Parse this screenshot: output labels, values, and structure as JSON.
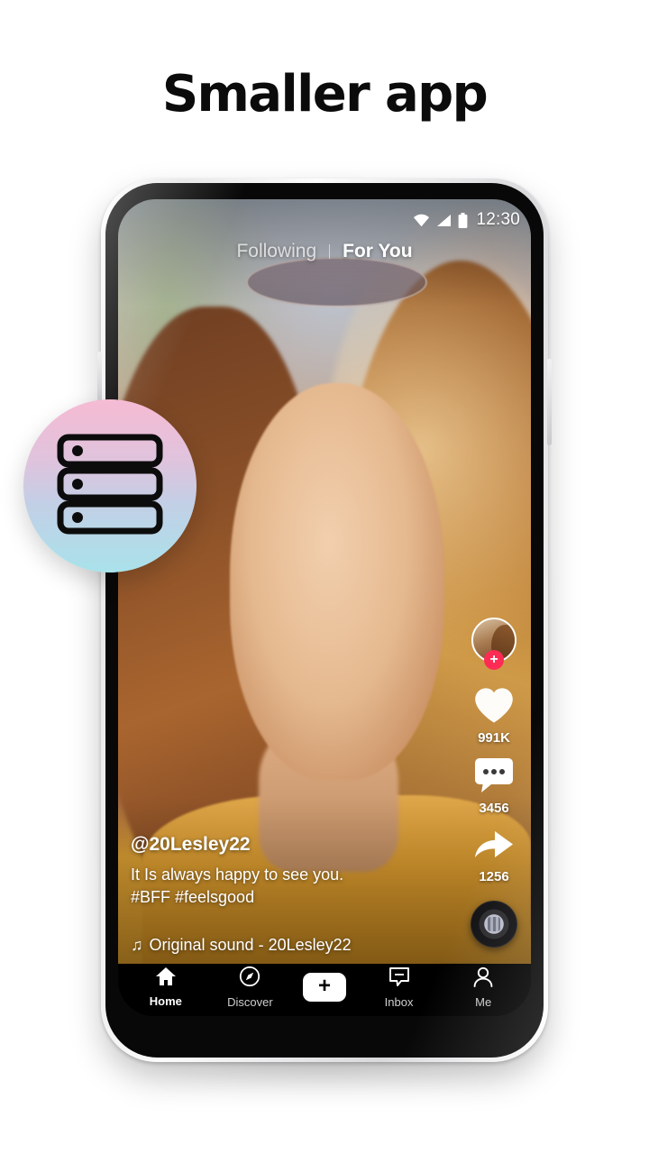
{
  "headline": "Smaller app",
  "phone": {
    "status_bar": {
      "wifi_icon": "wifi-icon",
      "signal_icon": "signal-icon",
      "battery_icon": "battery-icon",
      "time": "12:30"
    },
    "top_tabs": {
      "following": "Following",
      "for_you": "For You",
      "active": "For You"
    },
    "video": {
      "caption": {
        "username": "@20Lesley22",
        "line1": "It Is always happy to see you.",
        "line2": "#BFF #feelsgood",
        "music_note_icon": "music-note-icon",
        "music": "Original sound - 20Lesley22"
      },
      "actions": [
        {
          "name": "avatar",
          "icon": "avatar-icon",
          "badge": "+",
          "count": ""
        },
        {
          "name": "like",
          "icon": "heart-icon",
          "count": "991K"
        },
        {
          "name": "comment",
          "icon": "comment-icon",
          "count": "3456"
        },
        {
          "name": "share",
          "icon": "share-arrow-icon",
          "count": "1256"
        },
        {
          "name": "sound-disc",
          "icon": "vinyl-record-icon",
          "count": ""
        }
      ]
    },
    "nav": [
      {
        "label": "Home",
        "icon": "home-icon",
        "active": true
      },
      {
        "label": "Discover",
        "icon": "compass-icon",
        "active": false
      },
      {
        "label": "",
        "icon": "plus-create-icon",
        "active": false,
        "plus": "+"
      },
      {
        "label": "Inbox",
        "icon": "inbox-message-icon",
        "active": false
      },
      {
        "label": "Me",
        "icon": "person-icon",
        "active": false
      }
    ]
  },
  "badge": {
    "icon": "server-storage-icon",
    "gradient_start": "#f6bbd3",
    "gradient_end": "#a9e2ea"
  },
  "colors": {
    "accent_pink": "#fe2c55",
    "accent_cyan": "#25f4ee",
    "background": "#ffffff",
    "text": "#0b0b0b"
  }
}
